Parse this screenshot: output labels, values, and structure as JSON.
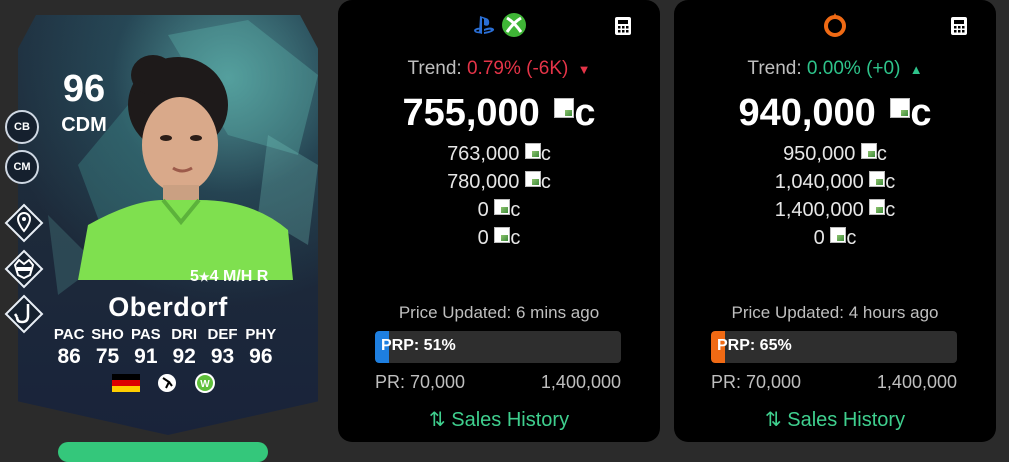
{
  "player": {
    "rating": "96",
    "position": "CDM",
    "alt_positions": [
      "CB",
      "CM"
    ],
    "skills": "5",
    "weakfoot": "4",
    "workrate": "M/H R",
    "name": "Oberdorf",
    "stats": [
      {
        "label": "PAC",
        "value": "86"
      },
      {
        "label": "SHO",
        "value": "75"
      },
      {
        "label": "PAS",
        "value": "91"
      },
      {
        "label": "DRI",
        "value": "92"
      },
      {
        "label": "DEF",
        "value": "93"
      },
      {
        "label": "PHY",
        "value": "96"
      }
    ],
    "playstyles": [
      "location-pin-icon",
      "raccoon-icon",
      "hook-icon"
    ],
    "badges": [
      "germany-flag",
      "league-logo",
      "wolfsburg-club-logo"
    ]
  },
  "panels": [
    {
      "platform_icons": [
        "playstation-icon",
        "xbox-icon"
      ],
      "trend_label": "Trend:",
      "trend_value": "0.79% (-6K)",
      "trend_direction": "down",
      "main_price": "755,000",
      "coin_suffix": "c",
      "alt_prices": [
        "763,000",
        "780,000",
        "0",
        "0"
      ],
      "updated": "Price Updated: 6 mins ago",
      "prp_label": "PRP: 51%",
      "prp_color": "#1e7fe0",
      "pr_min": "PR: 70,000",
      "pr_max": "1,400,000",
      "sales_label": "Sales History"
    },
    {
      "platform_icons": [
        "origin-icon"
      ],
      "trend_label": "Trend:",
      "trend_value": "0.00% (+0)",
      "trend_direction": "up",
      "main_price": "940,000",
      "coin_suffix": "c",
      "alt_prices": [
        "950,000",
        "1,040,000",
        "1,400,000",
        "0"
      ],
      "updated": "Price Updated: 4 hours ago",
      "prp_label": "PRP: 65%",
      "prp_color": "#f06a14",
      "pr_min": "PR: 70,000",
      "pr_max": "1,400,000",
      "sales_label": "Sales History"
    }
  ],
  "colors": {
    "trend_down": "#e53448",
    "trend_up": "#2ec48b",
    "sales": "#3fcf8e"
  }
}
